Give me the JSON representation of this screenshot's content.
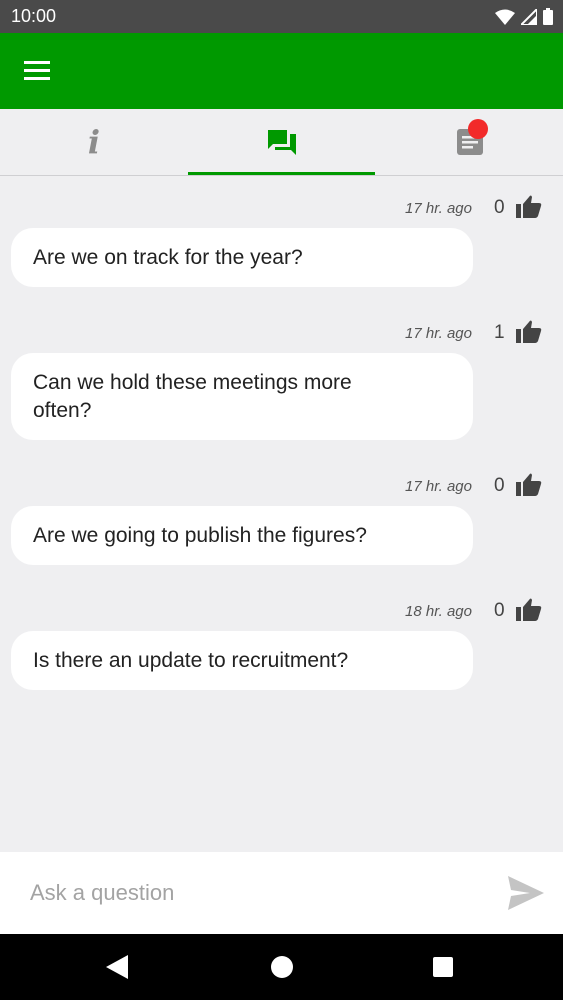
{
  "status_bar": {
    "time": "10:00"
  },
  "ask": {
    "placeholder": "Ask a question"
  },
  "questions": [
    {
      "time": "17 hr. ago",
      "votes": "0",
      "text": "Are we on track for the year?"
    },
    {
      "time": "17 hr. ago",
      "votes": "1",
      "text": "Can we hold these meetings more often?"
    },
    {
      "time": "17 hr. ago",
      "votes": "0",
      "text": "Are we going to publish the figures?"
    },
    {
      "time": "18 hr. ago",
      "votes": "0",
      "text": "Is there an update to recruitment?"
    }
  ],
  "colors": {
    "brand": "#009900",
    "badge": "#f22a2a",
    "background": "#efeff1"
  },
  "icons": [
    "menu-icon",
    "info-icon",
    "chat-icon",
    "document-icon",
    "thumbs-up-icon",
    "send-icon",
    "wifi-icon",
    "signal-icon",
    "battery-icon"
  ]
}
